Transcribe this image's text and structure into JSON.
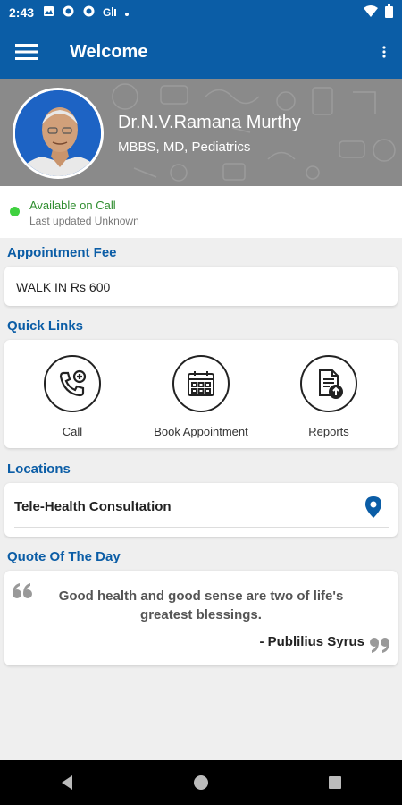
{
  "status_bar": {
    "time": "2:43",
    "left_icons": [
      "image-icon",
      "sync-icon",
      "sync-icon",
      "g-signal-icon",
      "dot-icon"
    ],
    "right_icons": [
      "wifi-icon",
      "battery-icon"
    ]
  },
  "app_bar": {
    "title": "Welcome",
    "menu_icon": "hamburger-menu-icon",
    "more_icon": "more-vert-icon",
    "color": "#0b5da6"
  },
  "doctor": {
    "name": "Dr.N.V.Ramana Murthy",
    "qualification": "MBBS, MD, Pediatrics"
  },
  "availability": {
    "status": "Available on Call",
    "updated": "Last updated Unknown",
    "status_color": "#3fd13f"
  },
  "appointment_fee": {
    "title": "Appointment Fee",
    "value": "WALK IN Rs 600"
  },
  "quick_links": {
    "title": "Quick Links",
    "items": [
      {
        "label": "Call",
        "icon": "phone-plus-icon"
      },
      {
        "label": "Book Appointment",
        "icon": "calendar-icon"
      },
      {
        "label": "Reports",
        "icon": "report-upload-icon"
      }
    ]
  },
  "locations": {
    "title": "Locations",
    "items": [
      {
        "name": "Tele-Health Consultation",
        "icon": "location-pin-icon"
      }
    ]
  },
  "quote": {
    "title": "Quote Of The Day",
    "text": "Good health and good sense are two of life's greatest blessings.",
    "author": "- Publilius Syrus"
  },
  "nav_bar": {
    "icons": [
      "back-icon",
      "home-icon",
      "recents-icon"
    ]
  }
}
